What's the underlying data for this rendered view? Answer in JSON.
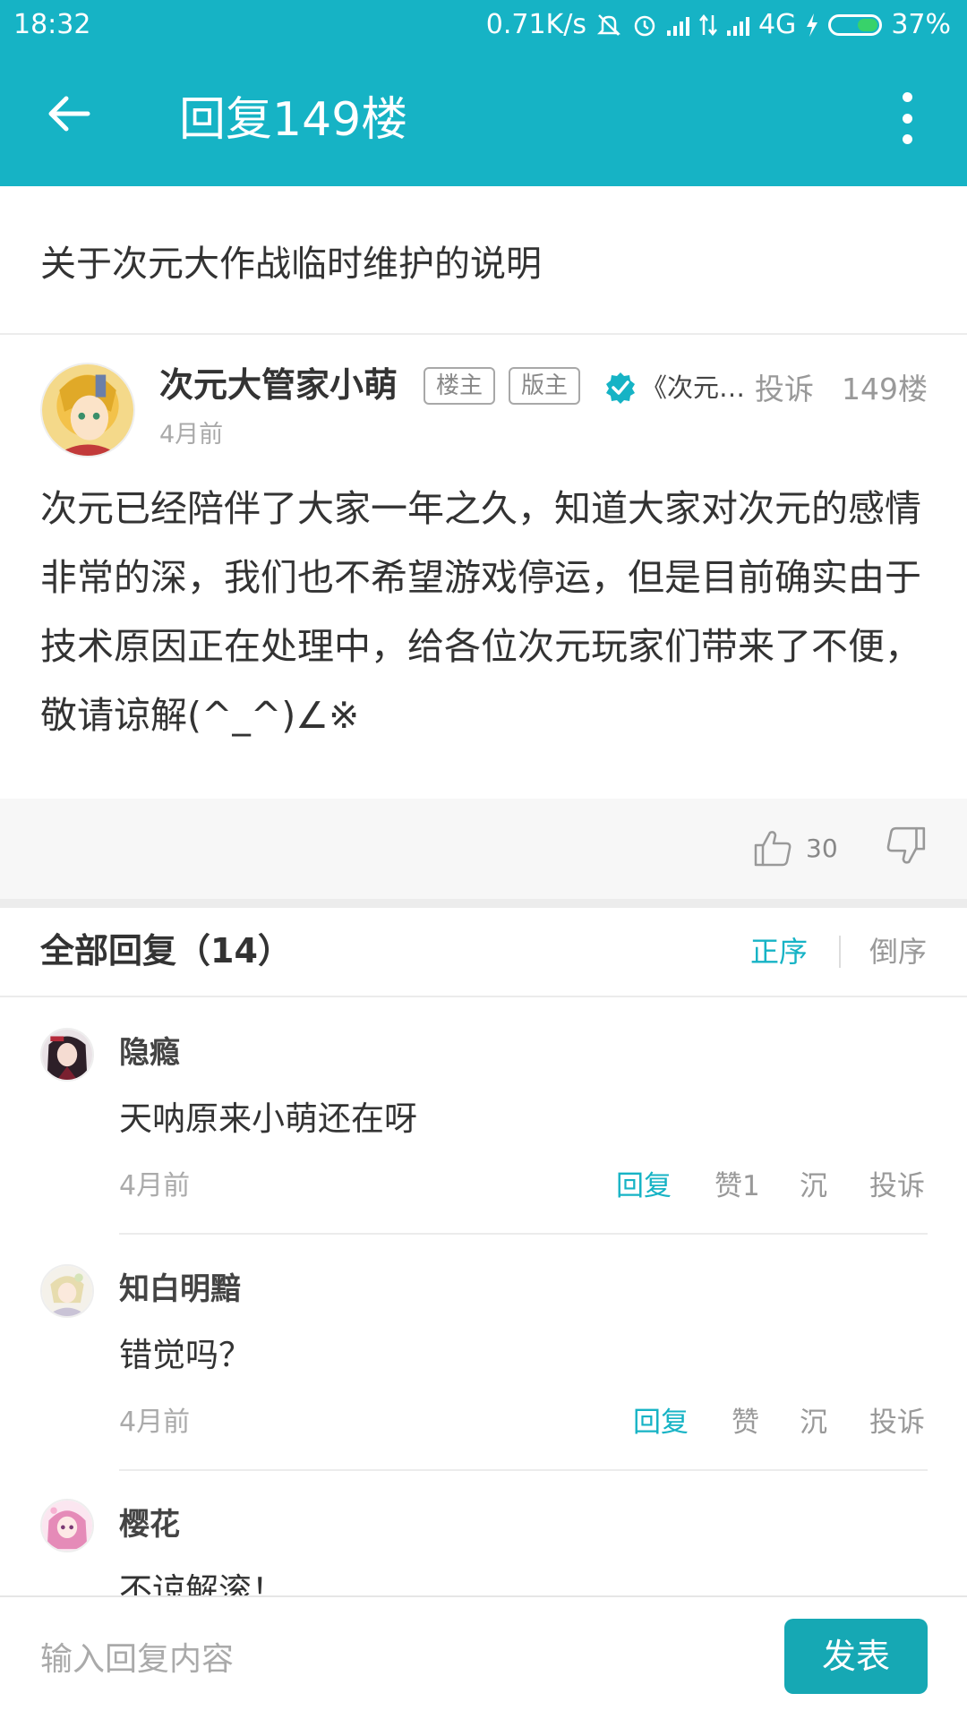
{
  "colors": {
    "accent": "#16b3c5",
    "submit": "#16a8b4",
    "verified": "#16b3c5",
    "battery_fill": "#38d26a"
  },
  "status_bar": {
    "time": "18:32",
    "network_speed": "0.71K/s",
    "network_type": "4G",
    "battery_percent": "37%",
    "battery_level": 0.37,
    "icons": [
      "mute-bell-icon",
      "alarm-icon",
      "signal-icon",
      "data-arrows-icon",
      "signal-icon",
      "charging-icon",
      "battery-icon"
    ]
  },
  "toolbar": {
    "title": "回复149楼",
    "back_icon": "arrow-left-icon",
    "more_icon": "vertical-dots-icon"
  },
  "topic": {
    "title": "关于次元大作战临时维护的说明"
  },
  "post": {
    "author": "次元大管家小萌",
    "tags": [
      "楼主",
      "版主"
    ],
    "game": "《次元大…",
    "complain_label": "投诉",
    "floor": "149楼",
    "time": "4月前",
    "body": "次元已经陪伴了大家一年之久，知道大家对次元的感情非常的深，我们也不希望游戏停运，但是目前确实由于技术原因正在处理中，给各位次元玩家们带来了不便，敬请谅解(^_^)∠※",
    "likes": "30"
  },
  "replies_header": {
    "title": "全部回复（14）",
    "sort_asc": "正序",
    "sort_desc": "倒序"
  },
  "replies": [
    {
      "name": "隐瘾",
      "text": "天呐原来小萌还在呀",
      "time": "4月前",
      "reply_label": "回复",
      "like_label": "赞1",
      "sink_label": "沉",
      "complain_label": "投诉"
    },
    {
      "name": "知白明黯",
      "text": "错觉吗？",
      "time": "4月前",
      "reply_label": "回复",
      "like_label": "赞",
      "sink_label": "沉",
      "complain_label": "投诉"
    },
    {
      "name": "樱花",
      "text": "不谅解滚！"
    }
  ],
  "composer": {
    "placeholder": "输入回复内容",
    "submit_label": "发表"
  }
}
